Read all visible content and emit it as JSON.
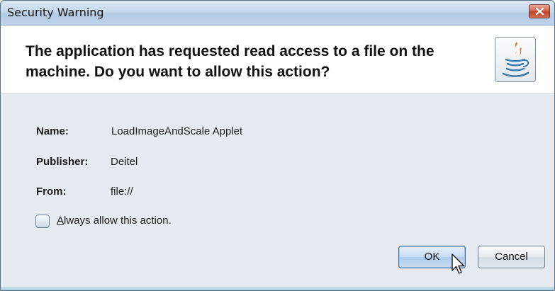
{
  "window": {
    "title": "Security Warning",
    "close_icon": "close-icon"
  },
  "header": {
    "message": "The application has requested read access to a file on the machine.  Do you want to allow this action?",
    "logo_icon": "java-logo-icon"
  },
  "details": {
    "name_label": "Name:",
    "name_value": "LoadImageAndScale Applet",
    "publisher_label": "Publisher:",
    "publisher_value": "Deitel",
    "from_label": "From:",
    "from_value": "file://"
  },
  "checkbox": {
    "mnemonic": "A",
    "label_rest": "lways allow this action.",
    "checked": false
  },
  "buttons": {
    "ok": "OK",
    "cancel": "Cancel"
  },
  "colors": {
    "accent": "#3f6a93",
    "close": "#c04326",
    "background": "#e6ebf1"
  }
}
